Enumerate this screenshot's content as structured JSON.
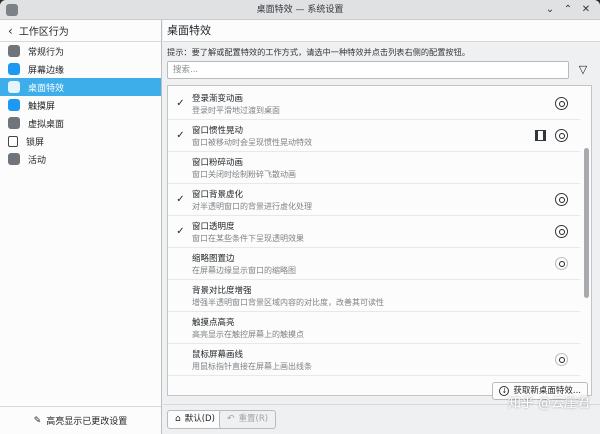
{
  "window": {
    "title": "桌面特效 — 系统设置"
  },
  "sidebar": {
    "header": "工作区行为",
    "items": [
      {
        "label": "常规行为",
        "icon": "general-behavior-icon"
      },
      {
        "label": "屏幕边缘",
        "icon": "screen-edges-icon"
      },
      {
        "label": "桌面特效",
        "icon": "desktop-effects-icon",
        "active": true
      },
      {
        "label": "触摸屏",
        "icon": "touchscreen-icon"
      },
      {
        "label": "虚拟桌面",
        "icon": "virtual-desktops-icon"
      },
      {
        "label": "锁屏",
        "icon": "lock-icon"
      },
      {
        "label": "活动",
        "icon": "activities-icon"
      }
    ],
    "footer": "高亮显示已更改设置"
  },
  "main": {
    "title": "桌面特效",
    "hint": "提示：要了解或配置特效的工作方式，请选中一种特效并点击列表右侧的配置按钮。",
    "search_placeholder": "搜索...",
    "effects": [
      {
        "title": "登录渐变动画",
        "desc": "登录时平滑地过渡到桌面",
        "checked": true,
        "config": true,
        "video": false
      },
      {
        "title": "窗口惯性晃动",
        "desc": "窗口被移动时会呈现惯性晃动特效",
        "checked": true,
        "config": true,
        "video": true
      },
      {
        "title": "窗口粉碎动画",
        "desc": "窗口关闭时绘制粉碎飞散动画",
        "checked": false,
        "config": false,
        "video": false
      },
      {
        "title": "窗口背景虚化",
        "desc": "对半透明窗口的背景进行虚化处理",
        "checked": true,
        "config": true,
        "video": false
      },
      {
        "title": "窗口透明度",
        "desc": "窗口在某些条件下呈现透明效果",
        "checked": true,
        "config": true,
        "video": false
      },
      {
        "title": "缩略图置边",
        "desc": "在屏幕边缘显示窗口的缩略图",
        "checked": false,
        "config": "dim",
        "video": false
      },
      {
        "title": "背景对比度增强",
        "desc": "增强半透明窗口背景区域内容的对比度，改善其可读性",
        "checked": false,
        "config": false,
        "video": false
      },
      {
        "title": "触摸点高亮",
        "desc": "高亮显示在触控屏幕上的触摸点",
        "checked": false,
        "config": false,
        "video": false
      },
      {
        "title": "鼠标屏幕画线",
        "desc": "用鼠标指针直接在屏幕上画出线条",
        "checked": false,
        "config": "dim",
        "video": false
      }
    ],
    "get_new": "获取新桌面特效...",
    "btn_default": "默认(D)",
    "btn_reset": "重置(R)"
  },
  "watermark": "知乎 @云崖君"
}
